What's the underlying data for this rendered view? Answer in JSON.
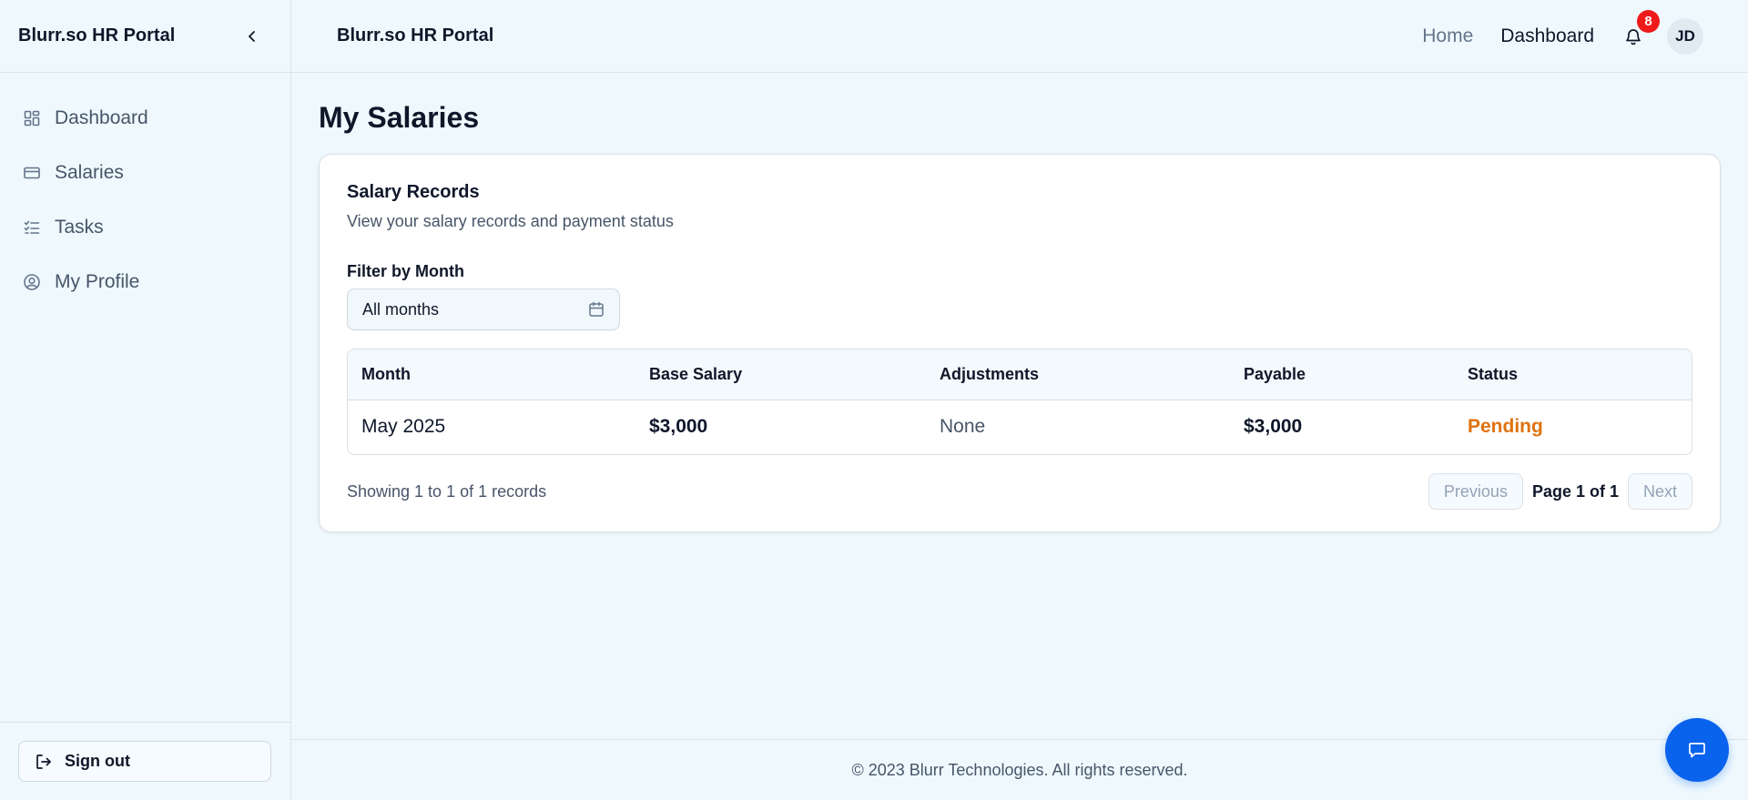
{
  "sidebar": {
    "title": "Blurr.so HR Portal",
    "items": [
      {
        "label": "Dashboard",
        "icon": "dashboard-icon"
      },
      {
        "label": "Salaries",
        "icon": "credit-card-icon"
      },
      {
        "label": "Tasks",
        "icon": "list-checks-icon"
      },
      {
        "label": "My Profile",
        "icon": "user-circle-icon"
      }
    ],
    "signout_label": "Sign out"
  },
  "topbar": {
    "title": "Blurr.so HR Portal",
    "links": [
      "Home",
      "Dashboard"
    ],
    "notification_count": "8",
    "avatar_initials": "JD"
  },
  "main": {
    "page_title": "My Salaries",
    "card": {
      "title": "Salary Records",
      "subtitle": "View your salary records and payment status",
      "filter_label": "Filter by Month",
      "filter_value": "All months",
      "table": {
        "headers": [
          "Month",
          "Base Salary",
          "Adjustments",
          "Payable",
          "Status"
        ],
        "rows": [
          {
            "month": "May 2025",
            "base_salary": "$3,000",
            "adjustments": "None",
            "payable": "$3,000",
            "status": "Pending"
          }
        ]
      },
      "showing_text": "Showing 1 to 1 of 1 records",
      "pager": {
        "previous": "Previous",
        "page_text": "Page 1 of 1",
        "next": "Next"
      }
    }
  },
  "footer": {
    "text": "© 2023 Blurr Technologies. All rights reserved."
  },
  "colors": {
    "accent": "#0a63ec",
    "badge": "#ef1a1a",
    "pending": "#e0720f",
    "background": "#eff9fd"
  }
}
